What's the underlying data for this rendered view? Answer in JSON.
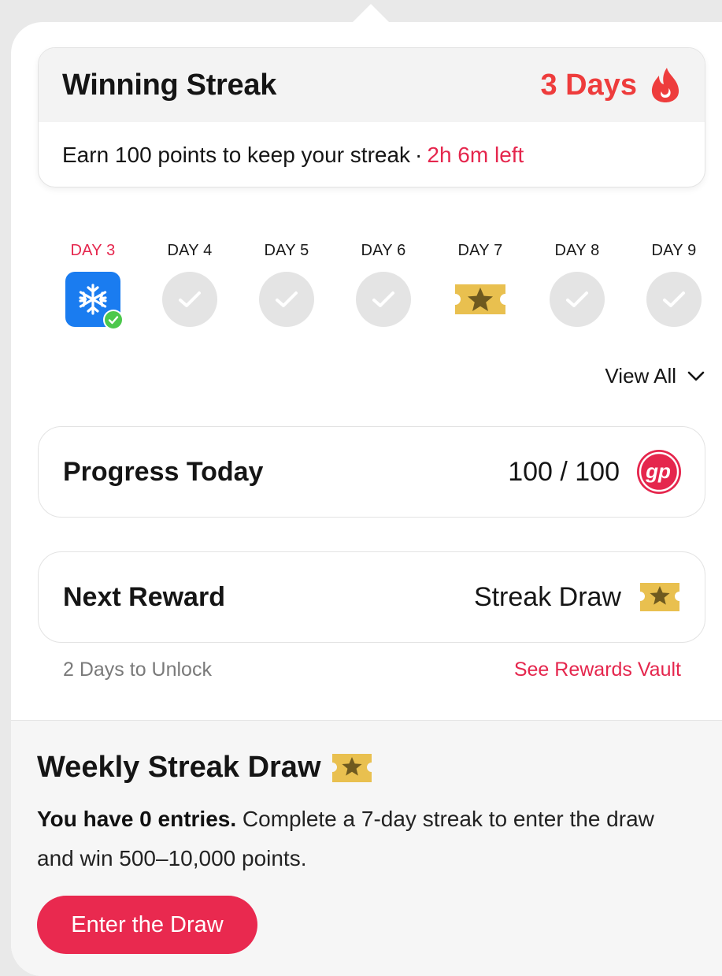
{
  "streak": {
    "title": "Winning Streak",
    "days": "3 Days",
    "subtitle": "Earn 100 points to keep your streak",
    "separator": "·",
    "time_left": "2h 6m left",
    "icon": "flame-icon",
    "accent": "#ee3c3c"
  },
  "days": [
    {
      "label": "DAY 3",
      "state": "freeze",
      "icon": "snowflake-icon"
    },
    {
      "label": "DAY 4",
      "state": "pending",
      "icon": "check-icon"
    },
    {
      "label": "DAY 5",
      "state": "pending",
      "icon": "check-icon"
    },
    {
      "label": "DAY 6",
      "state": "pending",
      "icon": "check-icon"
    },
    {
      "label": "DAY 7",
      "state": "reward",
      "icon": "ticket-star-icon"
    },
    {
      "label": "DAY 8",
      "state": "pending",
      "icon": "check-icon"
    },
    {
      "label": "DAY 9",
      "state": "pending",
      "icon": "check-icon"
    }
  ],
  "view_all": "View All",
  "progress": {
    "title": "Progress Today",
    "value": "100 / 100",
    "logo_text": "gp"
  },
  "next_reward": {
    "title": "Next Reward",
    "value": "Streak Draw",
    "unlock_text": "2 Days to Unlock",
    "vault_link": "See Rewards Vault"
  },
  "weekly": {
    "title": "Weekly Streak Draw",
    "entries": "You have 0 entries.",
    "description": " Complete a 7-day streak to enter the draw and win 500–10,000 points.",
    "button": "Enter the Draw"
  },
  "colors": {
    "brand": "#e5264d",
    "freeze": "#1a7cf0",
    "ticket": "#e9c04f"
  }
}
